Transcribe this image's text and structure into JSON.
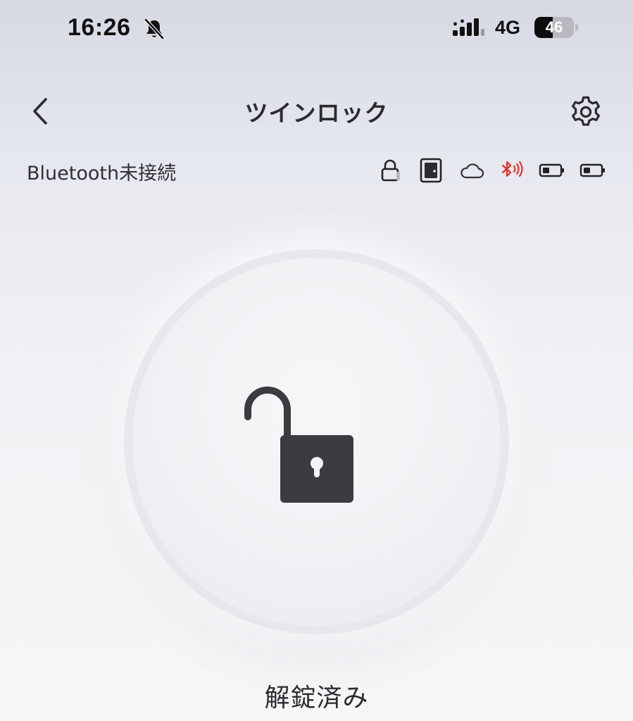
{
  "status_bar": {
    "time": "16:26",
    "network": "4G",
    "battery_level": "46",
    "battery_percent": 46,
    "icons": [
      "bell-slash-icon",
      "signal-icon",
      "battery-icon"
    ]
  },
  "nav": {
    "title": "ツインロック",
    "back_icon": "chevron-left-icon",
    "settings_icon": "gear-icon"
  },
  "connection": {
    "status_text": "Bluetooth未接続",
    "icons": [
      "lock-status-icon",
      "door-icon",
      "cloud-icon",
      "bluetooth-icon",
      "battery-icon",
      "battery-icon"
    ],
    "bluetooth_color": "#e0332f"
  },
  "lock": {
    "icon": "unlocked-padlock-icon",
    "state_label": "解錠済み",
    "icon_color": "#3b3b41"
  }
}
